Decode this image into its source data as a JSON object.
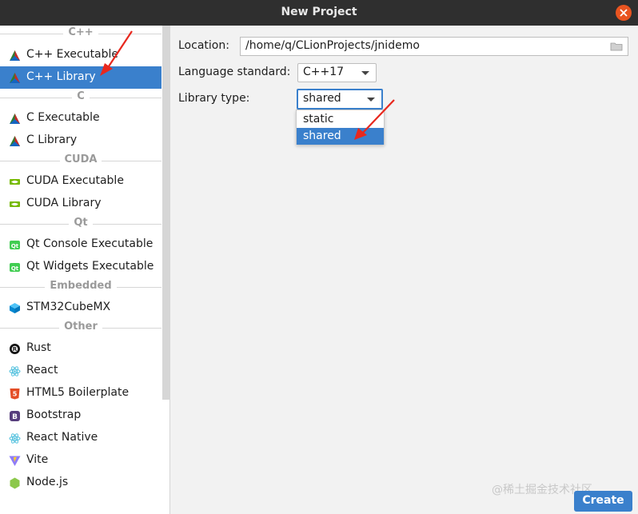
{
  "window": {
    "title": "New Project"
  },
  "sidebar": {
    "groups": [
      {
        "label": "C++",
        "items": [
          {
            "label": "C++ Executable",
            "icon": "clion-triangle-icon"
          },
          {
            "label": "C++ Library",
            "icon": "clion-triangle-icon",
            "selected": true
          }
        ]
      },
      {
        "label": "C",
        "items": [
          {
            "label": "C Executable",
            "icon": "clion-triangle-icon"
          },
          {
            "label": "C Library",
            "icon": "clion-triangle-icon"
          }
        ]
      },
      {
        "label": "CUDA",
        "items": [
          {
            "label": "CUDA Executable",
            "icon": "cuda-icon"
          },
          {
            "label": "CUDA Library",
            "icon": "cuda-icon"
          }
        ]
      },
      {
        "label": "Qt",
        "items": [
          {
            "label": "Qt Console Executable",
            "icon": "qt-icon"
          },
          {
            "label": "Qt Widgets Executable",
            "icon": "qt-icon"
          }
        ]
      },
      {
        "label": "Embedded",
        "items": [
          {
            "label": "STM32CubeMX",
            "icon": "cube-icon"
          }
        ]
      },
      {
        "label": "Other",
        "items": [
          {
            "label": "Rust",
            "icon": "rust-icon"
          },
          {
            "label": "React",
            "icon": "react-icon"
          },
          {
            "label": "HTML5 Boilerplate",
            "icon": "html5-icon"
          },
          {
            "label": "Bootstrap",
            "icon": "bootstrap-icon"
          },
          {
            "label": "React Native",
            "icon": "react-icon"
          },
          {
            "label": "Vite",
            "icon": "vite-icon"
          },
          {
            "label": "Node.js",
            "icon": "nodejs-icon"
          }
        ]
      }
    ]
  },
  "form": {
    "location_label": "Location:",
    "location_value": "/home/q/CLionProjects/jnidemo",
    "language_label": "Language standard:",
    "language_value": "C++17",
    "library_type_label": "Library type:",
    "library_type_value": "shared",
    "library_type_options": [
      "static",
      "shared"
    ]
  },
  "footer": {
    "watermark": "@稀土掘金技术社区",
    "create_label": "Create"
  },
  "colors": {
    "accent": "#3a80cc",
    "annotation_arrow": "#e8281e",
    "titlebar": "#2f2f2f",
    "close": "#e95420"
  }
}
